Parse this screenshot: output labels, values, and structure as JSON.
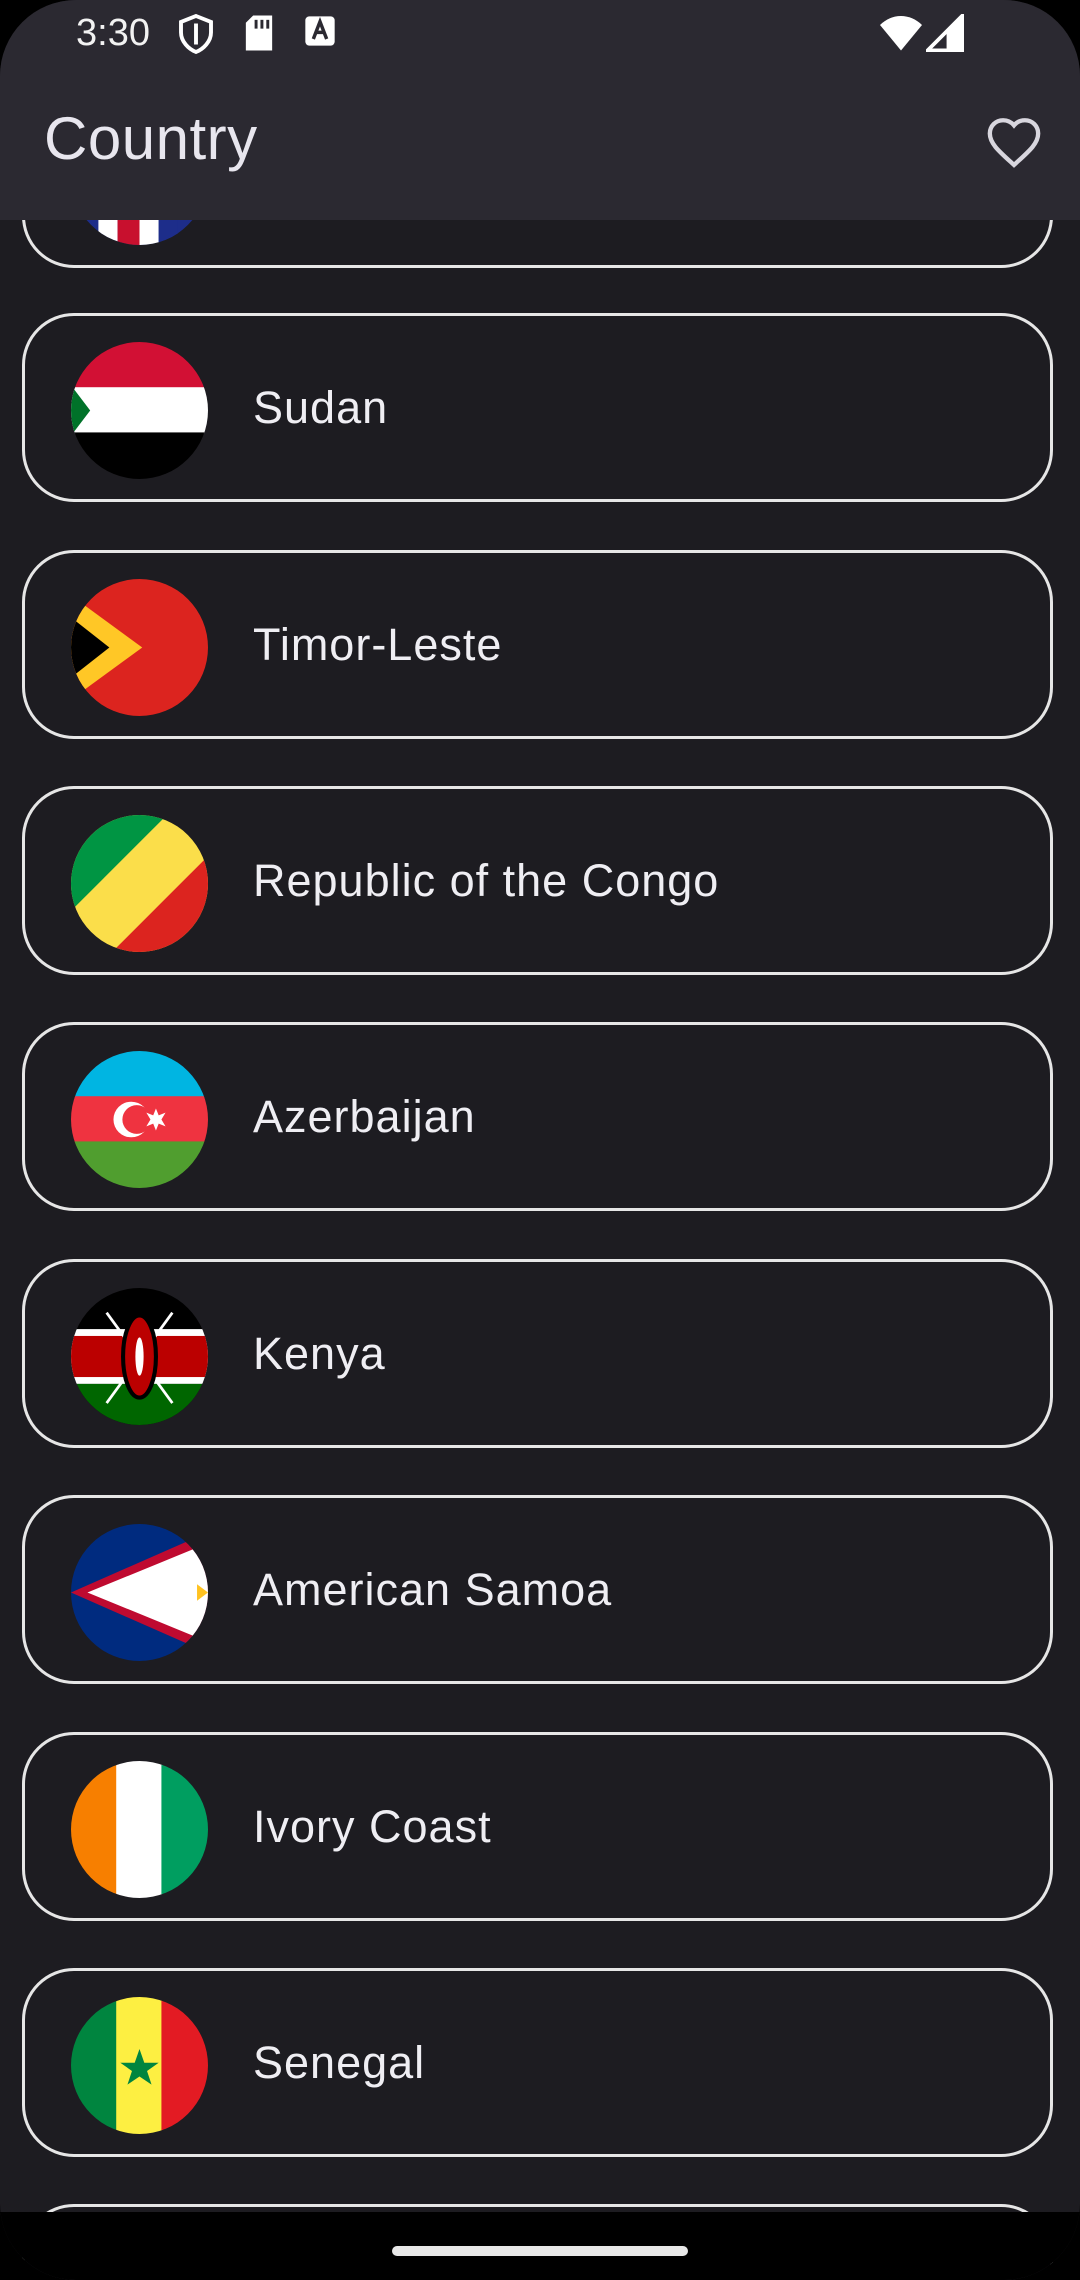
{
  "status_bar": {
    "time": "3:30",
    "icons": [
      "shield-icon",
      "sd-card-icon",
      "keyboard-a-icon",
      "wifi-icon",
      "cellular-signal-icon"
    ]
  },
  "app_bar": {
    "title": "Country",
    "favorite_icon": "heart-outline-icon"
  },
  "countries": [
    {
      "name": "",
      "flag": "partial-flag"
    },
    {
      "name": "Sudan",
      "flag": "sudan-flag"
    },
    {
      "name": "Timor-Leste",
      "flag": "timor-leste-flag"
    },
    {
      "name": "Republic of the Congo",
      "flag": "congo-flag"
    },
    {
      "name": "Azerbaijan",
      "flag": "azerbaijan-flag"
    },
    {
      "name": "Kenya",
      "flag": "kenya-flag"
    },
    {
      "name": "American Samoa",
      "flag": "american-samoa-flag"
    },
    {
      "name": "Ivory Coast",
      "flag": "ivory-coast-flag"
    },
    {
      "name": "Senegal",
      "flag": "senegal-flag"
    }
  ],
  "colors": {
    "background": "#1d1c21",
    "app_bar": "#2b2931",
    "card_border": "#e6e6e6",
    "text": "#efeef3"
  }
}
